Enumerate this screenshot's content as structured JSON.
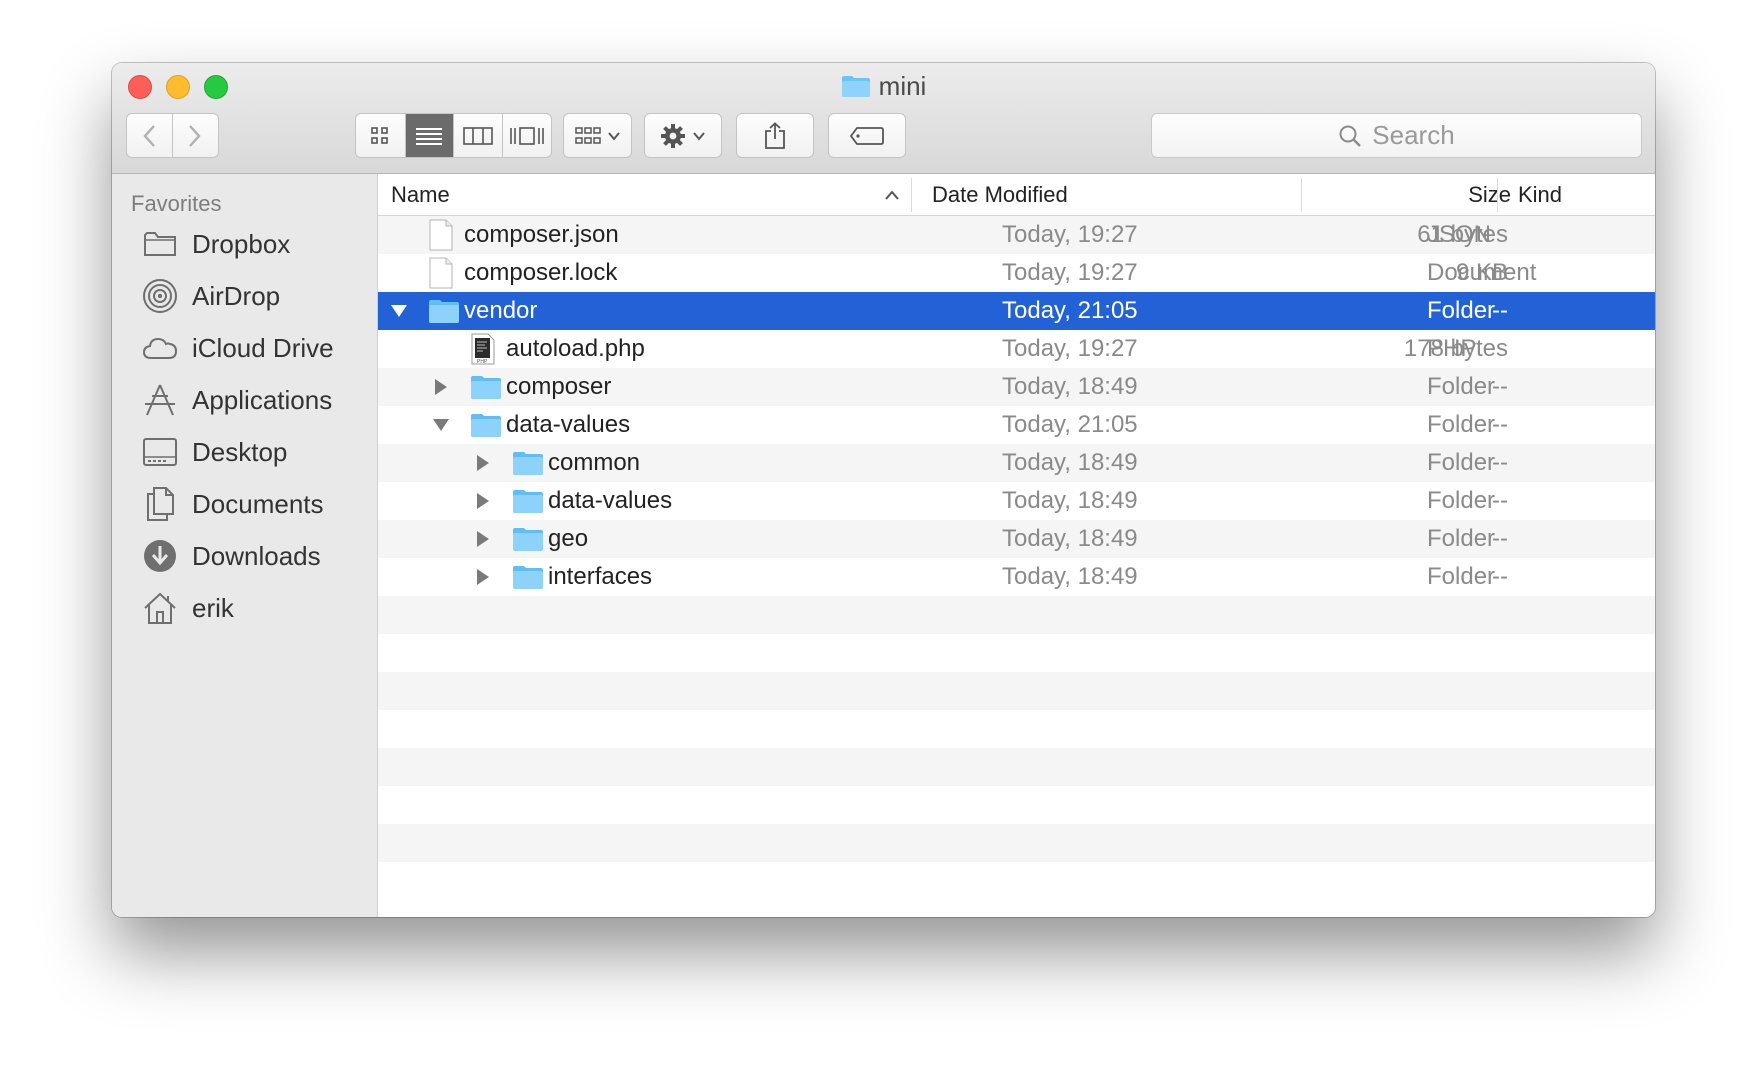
{
  "window": {
    "title": "mini"
  },
  "toolbar": {
    "search_placeholder": "Search"
  },
  "sidebar": {
    "heading": "Favorites",
    "items": [
      {
        "label": "Dropbox",
        "icon": "folder-icon"
      },
      {
        "label": "AirDrop",
        "icon": "airdrop-icon"
      },
      {
        "label": "iCloud Drive",
        "icon": "cloud-icon"
      },
      {
        "label": "Applications",
        "icon": "applications-icon"
      },
      {
        "label": "Desktop",
        "icon": "desktop-icon"
      },
      {
        "label": "Documents",
        "icon": "documents-icon"
      },
      {
        "label": "Downloads",
        "icon": "download-icon"
      },
      {
        "label": "erik",
        "icon": "home-icon"
      }
    ]
  },
  "columns": {
    "name": "Name",
    "date": "Date Modified",
    "size": "Size",
    "kind": "Kind"
  },
  "files": [
    {
      "name": "composer.json",
      "date": "Today, 19:27",
      "size": "61 bytes",
      "kind": "JSON",
      "indent": 0,
      "type": "file",
      "expand": "none"
    },
    {
      "name": "composer.lock",
      "date": "Today, 19:27",
      "size": "9 KB",
      "kind": "Document",
      "indent": 0,
      "type": "file",
      "expand": "none"
    },
    {
      "name": "vendor",
      "date": "Today, 21:05",
      "size": "--",
      "kind": "Folder",
      "indent": 0,
      "type": "folder",
      "expand": "open",
      "selected": true
    },
    {
      "name": "autoload.php",
      "date": "Today, 19:27",
      "size": "178 bytes",
      "kind": "PHP",
      "indent": 1,
      "type": "php",
      "expand": "none"
    },
    {
      "name": "composer",
      "date": "Today, 18:49",
      "size": "--",
      "kind": "Folder",
      "indent": 1,
      "type": "folder",
      "expand": "closed"
    },
    {
      "name": "data-values",
      "date": "Today, 21:05",
      "size": "--",
      "kind": "Folder",
      "indent": 1,
      "type": "folder",
      "expand": "open"
    },
    {
      "name": "common",
      "date": "Today, 18:49",
      "size": "--",
      "kind": "Folder",
      "indent": 2,
      "type": "folder",
      "expand": "closed"
    },
    {
      "name": "data-values",
      "date": "Today, 18:49",
      "size": "--",
      "kind": "Folder",
      "indent": 2,
      "type": "folder",
      "expand": "closed"
    },
    {
      "name": "geo",
      "date": "Today, 18:49",
      "size": "--",
      "kind": "Folder",
      "indent": 2,
      "type": "folder",
      "expand": "closed"
    },
    {
      "name": "interfaces",
      "date": "Today, 18:49",
      "size": "--",
      "kind": "Folder",
      "indent": 2,
      "type": "folder",
      "expand": "closed"
    }
  ]
}
